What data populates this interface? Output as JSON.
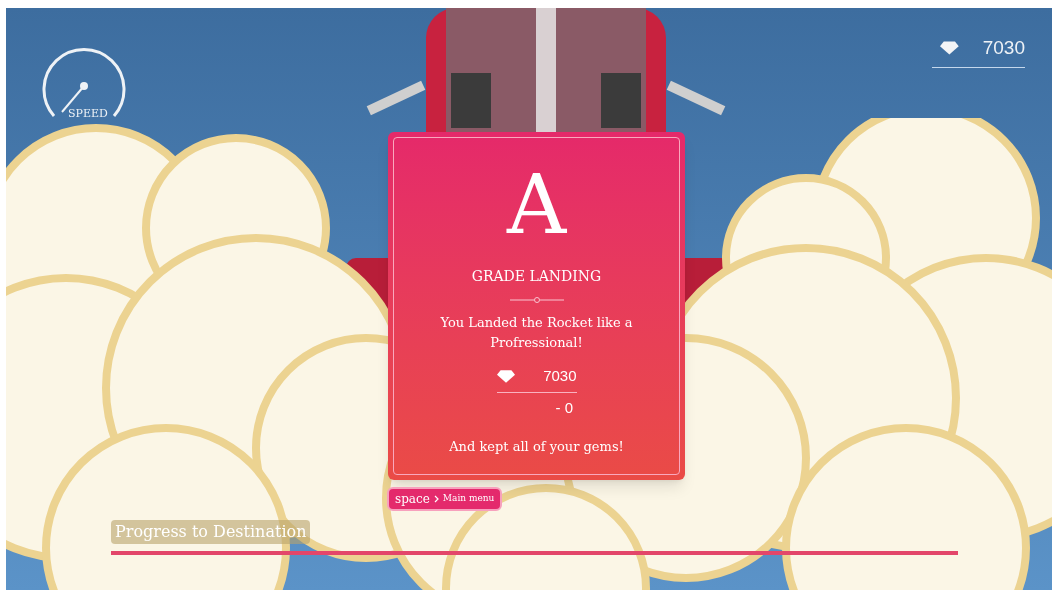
{
  "speedometer": {
    "label": "SPEED"
  },
  "gem_counter": {
    "count": "7030"
  },
  "result_card": {
    "grade": "A",
    "title": "GRADE LANDING",
    "message": "You Landed the Rocket like a Profressional!",
    "gems": "7030",
    "penalty": "- 0",
    "footer": "And kept all of your gems!"
  },
  "key_hint": {
    "key": "space",
    "action": "Main menu"
  },
  "progress": {
    "label": "Progress to Destination",
    "level": 1
  }
}
